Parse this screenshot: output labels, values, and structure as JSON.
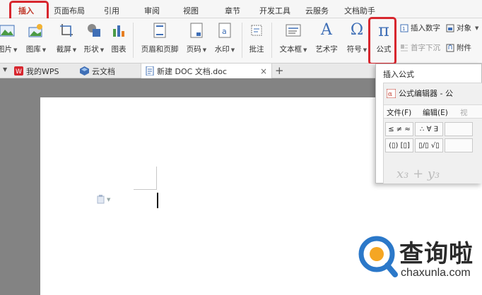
{
  "menu": {
    "tabs": [
      "插入",
      "页面布局",
      "引用",
      "审阅",
      "视图",
      "章节",
      "开发工具",
      "云服务",
      "文档助手"
    ],
    "active": "插入"
  },
  "ribbon": {
    "tools": {
      "picture": "图片",
      "gallery": "图库",
      "screenshot": "截屏",
      "shapes": "形状",
      "chart": "图表",
      "header_footer": "页眉和页脚",
      "page_number": "页码",
      "watermark": "水印",
      "comment": "批注",
      "textbox": "文本框",
      "wordart": "艺术字",
      "symbol": "符号",
      "formula": "公式"
    },
    "small": {
      "insert_number": "插入数字",
      "object": "对象",
      "drop_cap": "首字下沉",
      "attachment": "附件"
    },
    "colors": {
      "icon_blue": "#3f6fb6",
      "icon_green": "#4b9b45",
      "highlight_red": "#d7262e"
    }
  },
  "doc_tabs": {
    "items": [
      "我的WPS",
      "云文档",
      "新建 DOC 文档.doc"
    ],
    "active": "新建 DOC 文档.doc",
    "close_glyph": "×",
    "add_glyph": "+"
  },
  "popup": {
    "title": "插入公式",
    "editor_title": "公式编辑器 - 公",
    "menu": [
      "文件(F)",
      "编辑(E)",
      "视"
    ],
    "palette_row1": [
      "≤ ≠ ≈",
      "∴ ∀ ∃",
      ""
    ],
    "palette_row2": [
      "(▯) [▯]",
      "▯∕▯ √▯",
      ""
    ],
    "preview": "x₃ + y₃"
  },
  "watermark": {
    "text": "查询啦",
    "url": "chaxunla.com"
  }
}
